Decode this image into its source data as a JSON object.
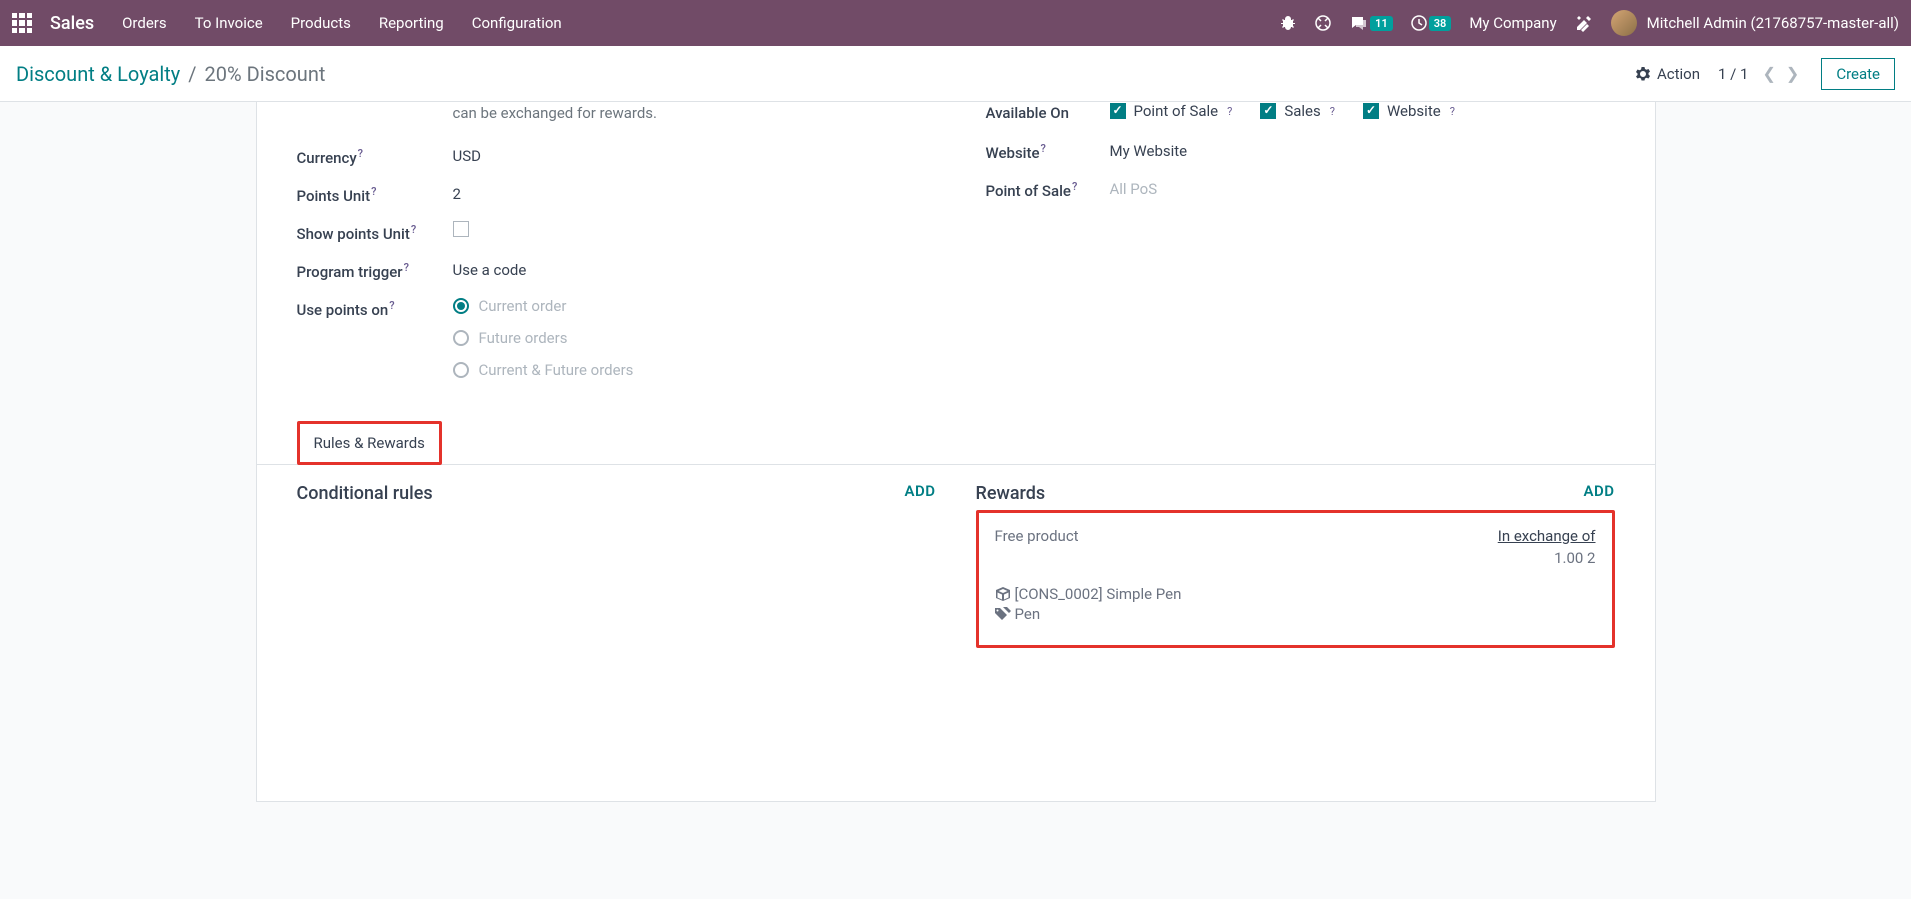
{
  "topbar": {
    "app": "Sales",
    "nav": [
      "Orders",
      "To Invoice",
      "Products",
      "Reporting",
      "Configuration"
    ],
    "messages_badge": "11",
    "activities_badge": "38",
    "company": "My Company",
    "user": "Mitchell Admin (21768757-master-all)"
  },
  "actionbar": {
    "breadcrumb_root": "Discount & Loyalty",
    "breadcrumb_current": "20% Discount",
    "action_label": "Action",
    "pager": "1 / 1",
    "create_label": "Create"
  },
  "form": {
    "description": "can be exchanged for rewards.",
    "fields": {
      "currency": {
        "label": "Currency",
        "value": "USD"
      },
      "points_unit": {
        "label": "Points Unit",
        "value": "2"
      },
      "show_points_unit": {
        "label": "Show points Unit"
      },
      "program_trigger": {
        "label": "Program trigger",
        "value": "Use a code"
      },
      "use_points_on": {
        "label": "Use points on",
        "options": [
          "Current order",
          "Future orders",
          "Current & Future orders"
        ]
      },
      "available_on": {
        "label": "Available On",
        "options": [
          "Point of Sale",
          "Sales",
          "Website"
        ]
      },
      "website": {
        "label": "Website",
        "value": "My Website"
      },
      "pos": {
        "label": "Point of Sale",
        "value": "All PoS"
      }
    }
  },
  "tabs": {
    "rules_rewards": "Rules & Rewards"
  },
  "sections": {
    "conditional_rules": "Conditional rules",
    "rewards": "Rewards",
    "add": "ADD"
  },
  "reward": {
    "type": "Free product",
    "exchange_label": "In exchange of",
    "exchange_value": "1.00 2",
    "product": "[CONS_0002] Simple Pen",
    "tag": "Pen"
  }
}
